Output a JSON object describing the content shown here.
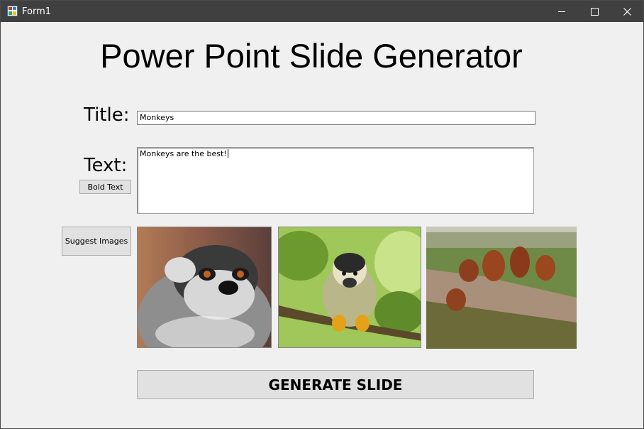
{
  "window": {
    "title": "Form1"
  },
  "header": {
    "title": "Power Point Slide Generator"
  },
  "form": {
    "title_label": "Title:",
    "title_value": "Monkeys",
    "text_label": "Text:",
    "text_value": "Monkeys are the best!",
    "bold_button": "Bold Text",
    "suggest_button": "Suggest Images",
    "generate_button": "GENERATE SLIDE"
  },
  "images": [
    {
      "icon": "lemur-photo"
    },
    {
      "icon": "squirrel-monkey-photo"
    },
    {
      "icon": "orangutans-photo"
    }
  ],
  "colors": {
    "titlebar": "#404040",
    "background": "#f0f0f0",
    "button": "#e1e1e1"
  }
}
